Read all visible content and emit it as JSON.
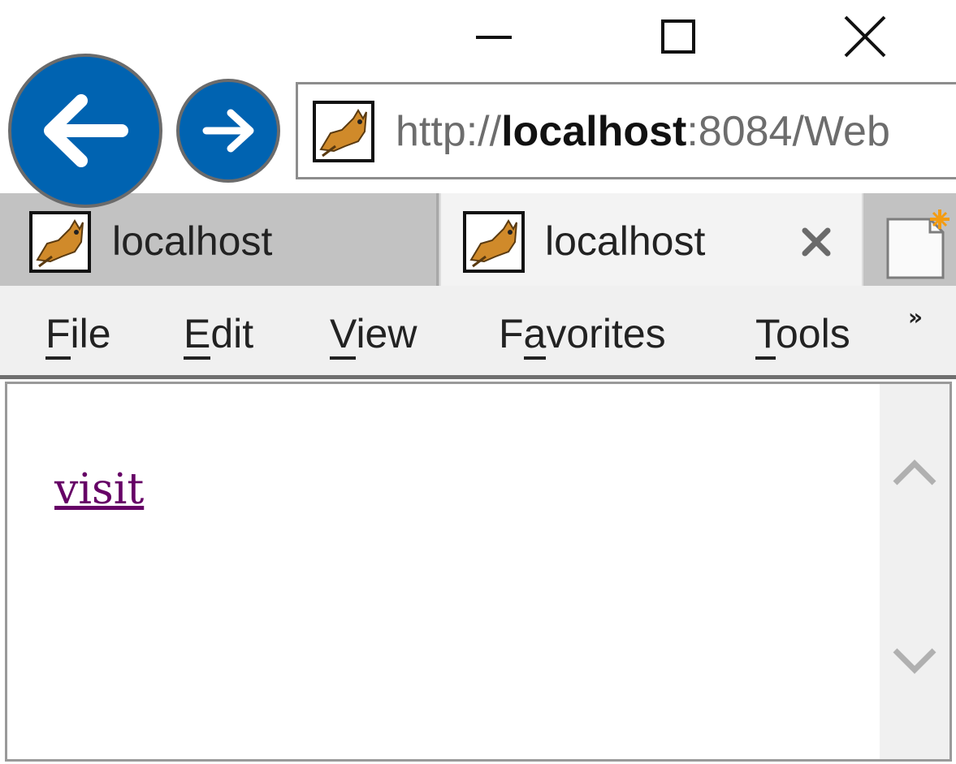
{
  "window": {
    "minimize_icon": "minimize-icon",
    "maximize_icon": "maximize-icon",
    "close_icon": "close-icon"
  },
  "navigation": {
    "back_icon": "arrow-left-icon",
    "forward_icon": "arrow-right-icon",
    "accent_color": "#0063b1"
  },
  "address_bar": {
    "url_prefix": "http://",
    "url_host": "localhost",
    "url_rest": ":8084/Web",
    "favicon": "tomcat-icon"
  },
  "tabs": [
    {
      "title": "localhost",
      "active": false,
      "favicon": "tomcat-icon"
    },
    {
      "title": "localhost",
      "active": true,
      "favicon": "tomcat-icon",
      "close_label": "×"
    }
  ],
  "new_tab_icon": "new-tab-icon",
  "menu": {
    "items": [
      {
        "label": "File",
        "mnemonic": "F",
        "rest": "ile"
      },
      {
        "label": "Edit",
        "mnemonic": "E",
        "rest": "dit"
      },
      {
        "label": "View",
        "mnemonic": "V",
        "rest": "iew"
      },
      {
        "label": "Favorites",
        "pre": "F",
        "mnemonic": "a",
        "rest": "vorites"
      },
      {
        "label": "Tools",
        "mnemonic": "T",
        "rest": "ools"
      }
    ],
    "more_label": "»"
  },
  "content": {
    "link_text": "visit",
    "link_color": "#660066"
  },
  "scrollbar": {
    "up_icon": "chevron-up-icon",
    "down_icon": "chevron-down-icon"
  }
}
